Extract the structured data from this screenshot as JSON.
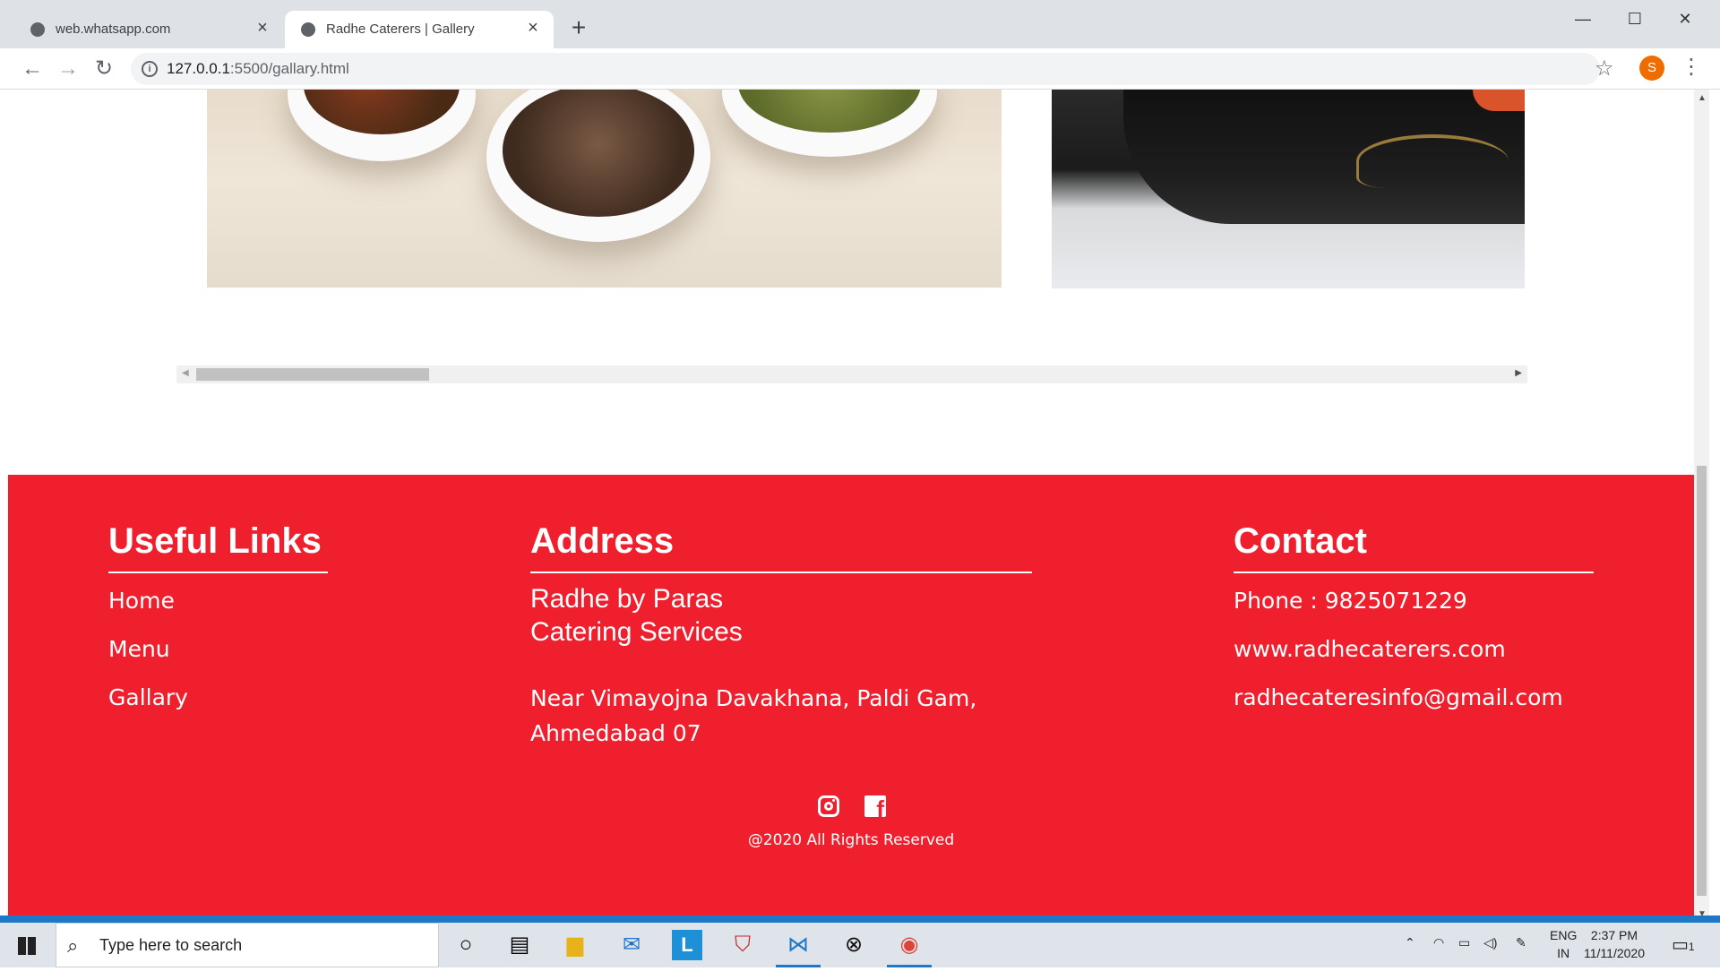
{
  "browser": {
    "tabs": [
      {
        "label": "web.whatsapp.com",
        "active": false
      },
      {
        "label": "Radhe Caterers | Gallery",
        "active": true
      }
    ],
    "url_host": "127.0.0.1",
    "url_rest": ":5500/gallary.html",
    "profile_initial": "S"
  },
  "footer": {
    "useful_links": {
      "title": "Useful Links",
      "items": [
        "Home",
        "Menu",
        "Gallary"
      ]
    },
    "address": {
      "title": "Address",
      "name_line1": "Radhe by Paras",
      "name_line2": "Catering Services",
      "line1": "Near Vimayojna Davakhana, Paldi Gam,",
      "line2": "Ahmedabad 07"
    },
    "contact": {
      "title": "Contact",
      "phone": "Phone : 9825071229",
      "website": "www.radhecaterers.com",
      "email": "radhecateresinfo@gmail.com"
    },
    "social": [
      "instagram-icon",
      "facebook-icon"
    ],
    "copyright": "@2020 All Rights Reserved",
    "background_color": "#ef1f2d"
  },
  "taskbar": {
    "search_placeholder": "Type here to search",
    "lang_line1": "ENG",
    "lang_line2": "IN",
    "time": "2:37 PM",
    "date": "11/11/2020",
    "notification_count": "1"
  }
}
